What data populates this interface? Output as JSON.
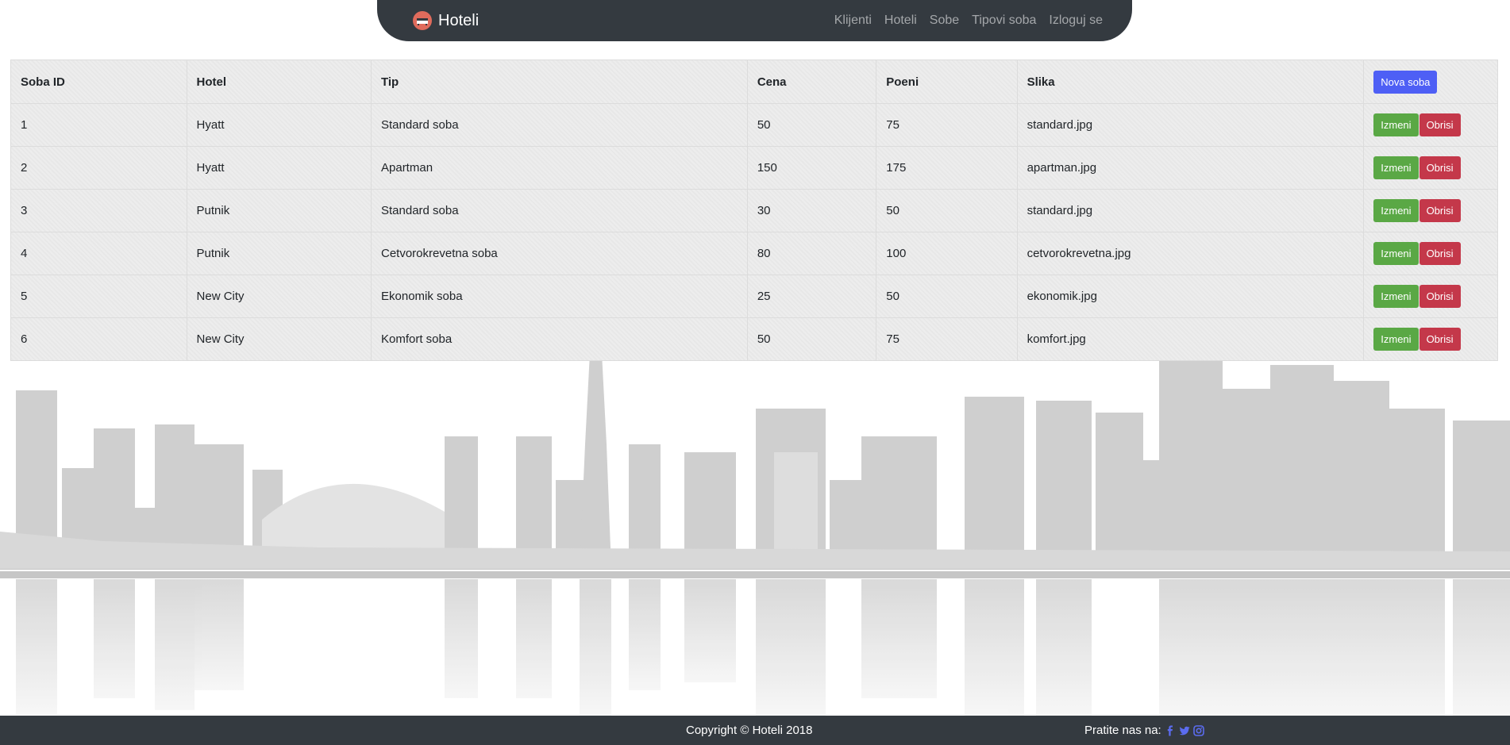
{
  "navbar": {
    "brand": "Hoteli",
    "brand_icon": "bed-icon",
    "links": [
      "Klijenti",
      "Hoteli",
      "Sobe",
      "Tipovi soba",
      "Izloguj se"
    ]
  },
  "table": {
    "headers": {
      "id": "Soba ID",
      "hotel": "Hotel",
      "tip": "Tip",
      "cena": "Cena",
      "poeni": "Poeni",
      "slika": "Slika"
    },
    "new_button": "Nova soba",
    "edit_label": "Izmeni",
    "delete_label": "Obrisi",
    "rows": [
      {
        "id": "1",
        "hotel": "Hyatt",
        "tip": "Standard soba",
        "cena": "50",
        "poeni": "75",
        "slika": "standard.jpg"
      },
      {
        "id": "2",
        "hotel": "Hyatt",
        "tip": "Apartman",
        "cena": "150",
        "poeni": "175",
        "slika": "apartman.jpg"
      },
      {
        "id": "3",
        "hotel": "Putnik",
        "tip": "Standard soba",
        "cena": "30",
        "poeni": "50",
        "slika": "standard.jpg"
      },
      {
        "id": "4",
        "hotel": "Putnik",
        "tip": "Cetvorokrevetna soba",
        "cena": "80",
        "poeni": "100",
        "slika": "cetvorokrevetna.jpg"
      },
      {
        "id": "5",
        "hotel": "New City",
        "tip": "Ekonomik soba",
        "cena": "25",
        "poeni": "50",
        "slika": "ekonomik.jpg"
      },
      {
        "id": "6",
        "hotel": "New City",
        "tip": "Komfort soba",
        "cena": "50",
        "poeni": "75",
        "slika": "komfort.jpg"
      }
    ]
  },
  "footer": {
    "copyright": "Copyright © Hoteli 2018",
    "follow": "Pratite nas na:",
    "social_icons": [
      "facebook-icon",
      "twitter-icon",
      "instagram-icon"
    ]
  },
  "colors": {
    "navbar": "#343a40",
    "primary": "#4e5ff5",
    "success": "#5aa845",
    "danger": "#c4384a",
    "social": "#5b6cf0"
  }
}
